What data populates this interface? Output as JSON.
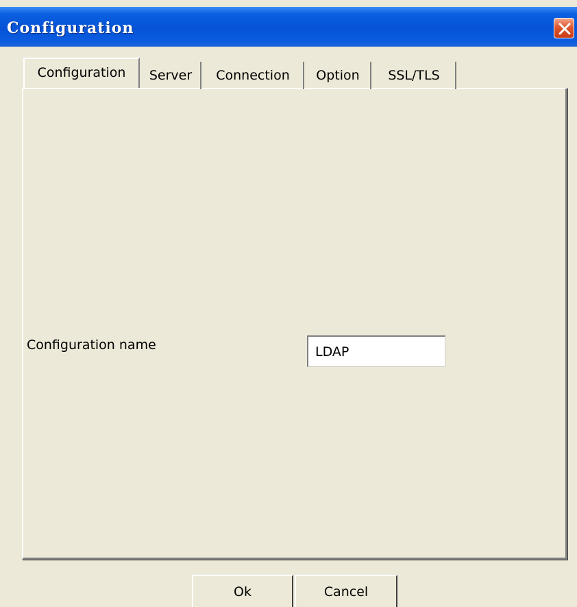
{
  "window": {
    "title": "Configuration",
    "title_color": "#ffffff",
    "titlebar_color": "#0653d6",
    "close_icon": "close-icon"
  },
  "tabs": [
    {
      "label": "Configuration",
      "active": true
    },
    {
      "label": "Server",
      "active": false
    },
    {
      "label": "Connection",
      "active": false
    },
    {
      "label": "Option",
      "active": false
    },
    {
      "label": "SSL/TLS",
      "active": false
    }
  ],
  "form": {
    "config_name_label": "Configuration name",
    "config_name_value": "LDAP"
  },
  "buttons": {
    "ok_label": "Ok",
    "cancel_label": "Cancel"
  },
  "colors": {
    "dialog_bg": "#ece9d8",
    "accent": "#0653d6",
    "close_red": "#e0562f"
  }
}
